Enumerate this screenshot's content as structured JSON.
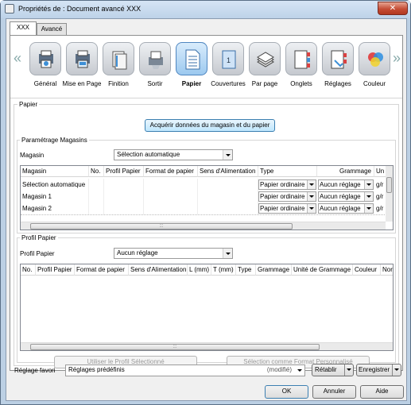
{
  "window": {
    "title": "Propriétés de : Document avancé XXX",
    "close_glyph": "✕"
  },
  "tabs": [
    "XXX",
    "Avancé"
  ],
  "nav": {
    "left": "«",
    "right": "»"
  },
  "iconbar": [
    {
      "label": "Général",
      "icon": "general-icon"
    },
    {
      "label": "Mise en Page",
      "icon": "layout-icon"
    },
    {
      "label": "Finition",
      "icon": "finishing-icon"
    },
    {
      "label": "Sortir",
      "icon": "output-icon"
    },
    {
      "label": "Papier",
      "icon": "paper-icon",
      "selected": true
    },
    {
      "label": "Couvertures",
      "icon": "covers-icon"
    },
    {
      "label": "Par page",
      "icon": "per-page-icon"
    },
    {
      "label": "Onglets",
      "icon": "tabs-icon"
    },
    {
      "label": "Réglages",
      "icon": "settings-icon"
    },
    {
      "label": "Couleur",
      "icon": "color-icon"
    }
  ],
  "paper": {
    "group_label": "Papier",
    "acquire_button": "Acquérir données du magasin et du papier",
    "trays_group": "Paramétrage Magasins",
    "tray_label": "Magasin",
    "tray_value": "Sélection automatique",
    "tray_table": {
      "columns": [
        "Magasin",
        "No.",
        "Profil Papier",
        "Format de papier",
        "Sens d'Alimentation",
        "Type",
        "Grammage",
        "Un"
      ],
      "rows": [
        {
          "name": "Sélection automatique",
          "type": "Papier ordinaire",
          "weight": "Aucun réglage",
          "unit": "g/r"
        },
        {
          "name": "Magasin 1",
          "type": "Papier ordinaire",
          "weight": "Aucun réglage",
          "unit": "g/r"
        },
        {
          "name": "Magasin 2",
          "type": "Papier ordinaire",
          "weight": "Aucun réglage",
          "unit": "g/r"
        }
      ]
    },
    "profile_group": "Profil Papier",
    "profile_label": "Profil Papier",
    "profile_value": "Aucun réglage",
    "profile_table": {
      "columns": [
        "No.",
        "Profil Papier",
        "Format de papier",
        "Sens d'Alimentation",
        "L (mm)",
        "T (mm)",
        "Type",
        "Grammage",
        "Unité de Grammage",
        "Couleur",
        "Nor"
      ]
    },
    "use_profile_button": "Utiliser le Profil Sélectionné",
    "custom_format_button": "Sélection comme Format Personnalisé"
  },
  "favorites": {
    "label": "Réglage favori",
    "value": "Réglages prédéfinis",
    "modified": "(modifié)",
    "restore": "Rétablir",
    "save": "Enregistrer"
  },
  "footer": {
    "ok": "OK",
    "cancel": "Annuler",
    "help": "Aide"
  }
}
